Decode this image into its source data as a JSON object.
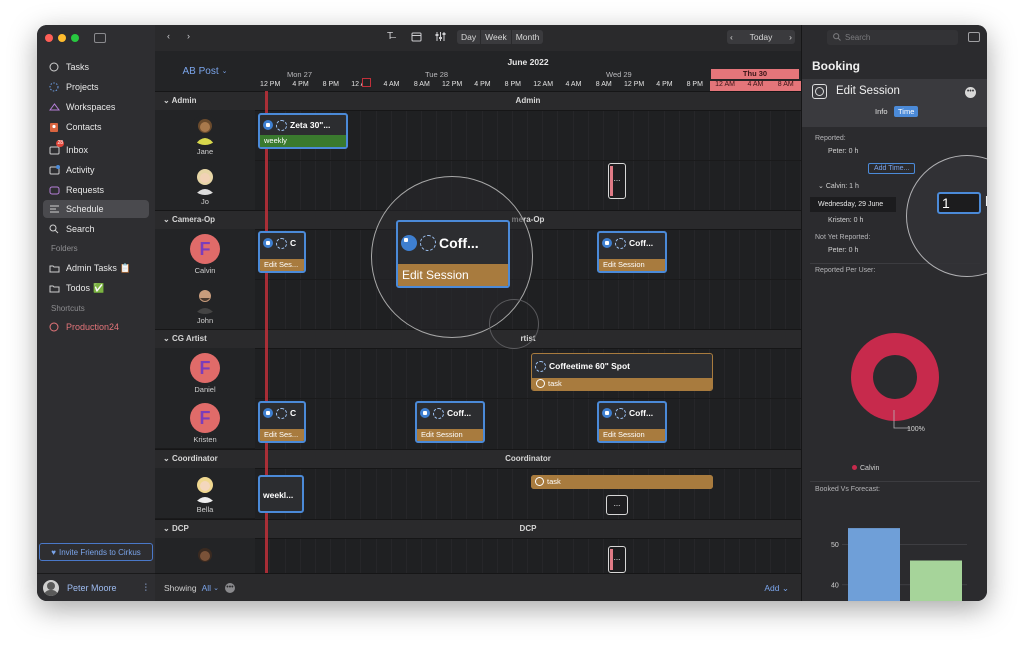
{
  "sidebar": {
    "items": [
      {
        "label": "Tasks",
        "icon": "circle-icon"
      },
      {
        "label": "Projects",
        "icon": "dashed-circle-icon"
      },
      {
        "label": "Workspaces",
        "icon": "workspaces-icon"
      },
      {
        "label": "Contacts",
        "icon": "contacts-icon"
      },
      {
        "label": "Inbox",
        "icon": "inbox-icon",
        "badge": "28"
      },
      {
        "label": "Activity",
        "icon": "activity-icon"
      },
      {
        "label": "Requests",
        "icon": "requests-icon"
      },
      {
        "label": "Schedule",
        "icon": "schedule-icon",
        "selected": true
      },
      {
        "label": "Search",
        "icon": "search-icon"
      }
    ],
    "folders_heading": "Folders",
    "folders": [
      {
        "label": "Admin Tasks",
        "emoji": "📋"
      },
      {
        "label": "Todos",
        "emoji": "✅"
      }
    ],
    "shortcuts_heading": "Shortcuts",
    "shortcuts": [
      {
        "label": "Production24"
      }
    ],
    "invite_label": "Invite Friends to Cirkus",
    "user_name": "Peter Moore"
  },
  "toolbar": {
    "views": [
      "Day",
      "Week",
      "Month"
    ],
    "today_label": "Today"
  },
  "schedule": {
    "project_label": "AB Post",
    "month_label": "June 2022",
    "days": [
      {
        "label": "Mon 27"
      },
      {
        "label": "Tue 28"
      },
      {
        "label": "Wed 29"
      },
      {
        "label": "Thu 30",
        "today": true
      }
    ],
    "hours": [
      "12 PM",
      "4 PM",
      "8 PM",
      "12 AM",
      "4 AM",
      "8 AM",
      "12 PM",
      "4 PM",
      "8 PM",
      "12 AM",
      "4 AM",
      "8 AM",
      "12 PM",
      "4 PM",
      "8 PM",
      "12 AM",
      "4 AM",
      "8 AM"
    ],
    "groups": [
      {
        "name": "Admin",
        "people": [
          "Jane",
          "Jo"
        ]
      },
      {
        "name": "Camera-Op",
        "people": [
          "Calvin",
          "John"
        ]
      },
      {
        "name": "CG Artist",
        "people": [
          "Daniel",
          "Kristen"
        ]
      },
      {
        "name": "Coordinator",
        "people": [
          "Bella"
        ]
      },
      {
        "name": "DCP",
        "people": [
          ""
        ]
      }
    ],
    "cards": {
      "jane_title": "Zeta 30\"...",
      "jane_sub": "weekly",
      "calvin1_title": "C",
      "calvin1_sub": "Edit Ses...",
      "calvin2_title": "Coff...",
      "calvin2_sub": "Edit Session",
      "daniel_title": "Coffeetime 60\" Spot",
      "daniel_sub": "task",
      "kristen1_title": "C",
      "kristen1_sub": "Edit Ses...",
      "kristen2_title": "Coff...",
      "kristen2_sub": "Edit Session",
      "kristen3_title": "Coff...",
      "kristen3_sub": "Edit Session",
      "bella1_title": "weekl...",
      "bella2_sub": "task",
      "more": "..."
    },
    "camera_op_partial": "mera-Op",
    "cg_artist_partial": "rtist"
  },
  "magnifier_left": {
    "title": "Coff...",
    "sub": "Edit Session"
  },
  "magnifier_right": {
    "value": "1",
    "unit": "h"
  },
  "footer": {
    "showing_label": "Showing",
    "filter_value": "All",
    "add_label": "Add"
  },
  "panel": {
    "search_placeholder": "Search",
    "title": "Booking",
    "heading": "Edit Session",
    "tabs": [
      "Info",
      "Time"
    ],
    "reported_label": "Reported:",
    "reported_peter": "Peter: 0 h",
    "add_time_label": "Add Time...",
    "calvin_row": "Calvin: 1 h",
    "date_label": "Wednesday, 29 June",
    "kristen_row": "Kristen: 0 h",
    "not_yet_label": "Not Yet Reported:",
    "not_yet_peter": "Peter: 0 h",
    "per_user_label": "Reported Per User:",
    "donut_pct": "100%",
    "donut_legend": "Calvin",
    "forecast_label": "Booked Vs Forecast:",
    "axis_50": "50",
    "axis_40": "40"
  },
  "colors": {
    "accent": "#4b8ad8",
    "donut": "#c72a4c",
    "today": "#e4757a",
    "booked": "#6f9fd8",
    "forecast": "#a6d49a"
  },
  "chart_data": [
    {
      "type": "pie",
      "title": "Reported Per User:",
      "categories": [
        "Calvin"
      ],
      "values": [
        100
      ],
      "labels": [
        "100%"
      ]
    },
    {
      "type": "bar",
      "title": "Booked Vs Forecast:",
      "series": [
        {
          "values": [
            54
          ]
        },
        {
          "values": [
            46
          ]
        }
      ],
      "ylim": [
        36,
        56
      ],
      "yticks": [
        40,
        50
      ]
    }
  ]
}
